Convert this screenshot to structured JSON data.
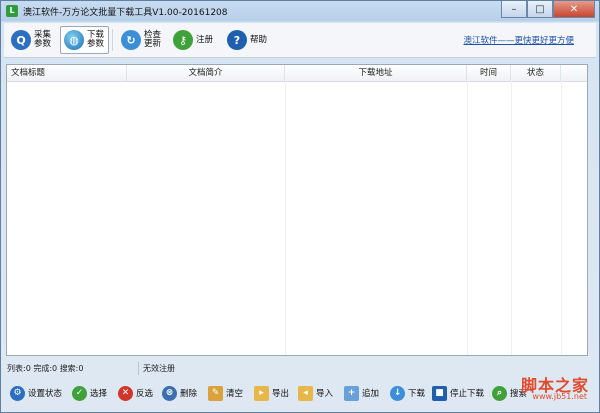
{
  "window": {
    "title": "澳江软件-万方论文批量下载工具V1.00-20161208",
    "controls": {
      "minimize": "–",
      "maximize": "□",
      "close": "✕"
    }
  },
  "toolbar": {
    "collect_params": [
      "采集",
      "参数"
    ],
    "download_params": [
      "下载",
      "参数"
    ],
    "check_update": [
      "检查",
      "更新"
    ],
    "register": "注册",
    "help": "帮助",
    "promo_link": "澳江软件——更快更好更方便"
  },
  "list": {
    "columns": [
      "文档标题",
      "文档简介",
      "下载地址",
      "时间",
      "状态"
    ],
    "rows": []
  },
  "status": {
    "list_count": "列表:0",
    "done_count": "完成:0",
    "search_count": "搜索:0",
    "registration": "无效注册"
  },
  "actions": {
    "set_status": "设置状态",
    "select": "选择",
    "invert": "反选",
    "delete": "删除",
    "clear": "清空",
    "export": "导出",
    "import": "导入",
    "append": "追加",
    "download": "下载",
    "stop_download": "停止下载",
    "last": "搜索"
  },
  "watermark": {
    "main": "脚本之家",
    "sub": "www.jb51.net"
  },
  "colors": {
    "accent_blue": "#2c6fc0",
    "green": "#2f9d3d",
    "red": "#d2352a",
    "link": "#1f50a8"
  }
}
